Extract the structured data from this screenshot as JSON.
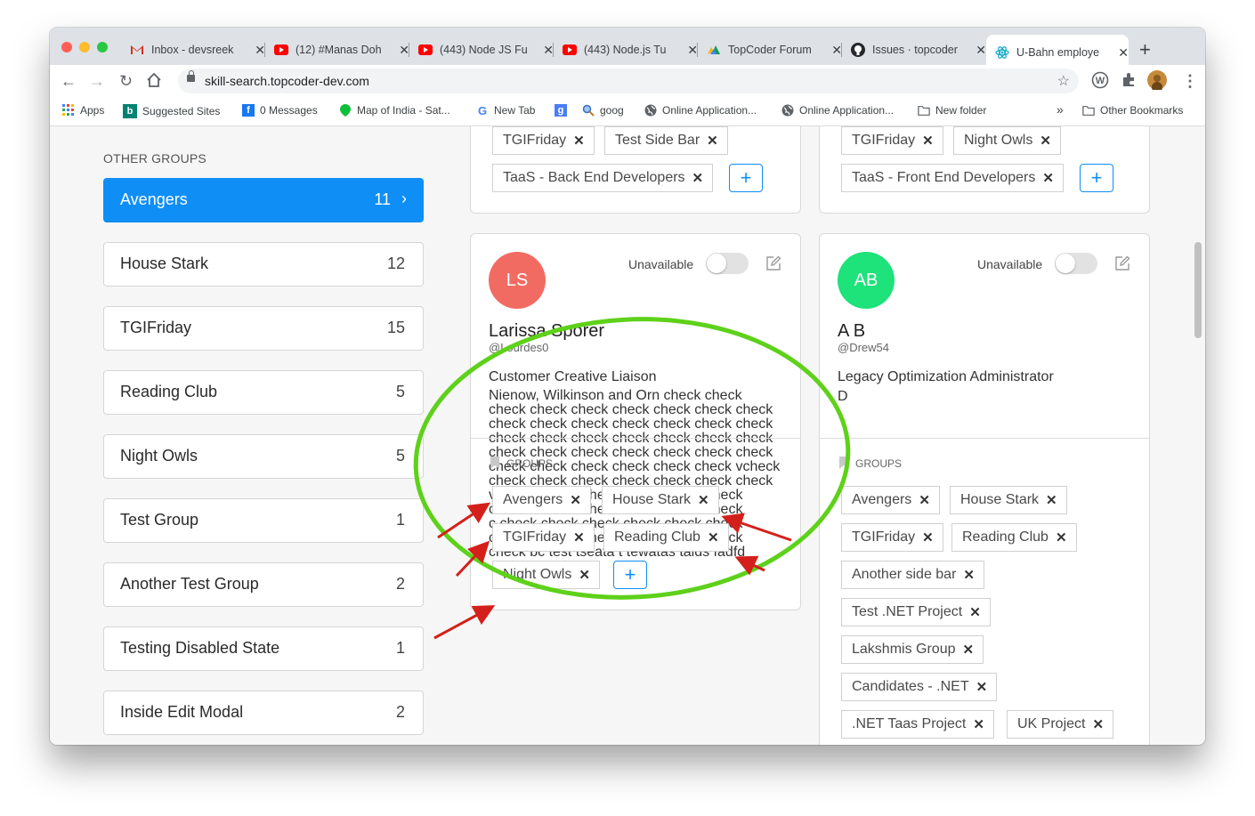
{
  "browser": {
    "tabs": [
      {
        "title": "Inbox - devsreek",
        "icon": "gmail-icon"
      },
      {
        "title": "(12) #Manas Doh",
        "icon": "youtube-icon"
      },
      {
        "title": "(443) Node JS Fu",
        "icon": "youtube-icon"
      },
      {
        "title": "(443) Node.js Tu",
        "icon": "youtube-icon"
      },
      {
        "title": "TopCoder Forum",
        "icon": "topcoder-icon"
      },
      {
        "title": "Issues · topcoder",
        "icon": "github-icon"
      },
      {
        "title": "U-Bahn employe",
        "icon": "react-icon"
      }
    ],
    "url": "skill-search.topcoder-dev.com",
    "bookmarks": [
      "Apps",
      "Suggested Sites",
      "0 Messages",
      "Map of India - Sat...",
      "New Tab",
      "goog",
      "Online Application...",
      "Online Application...",
      "New folder"
    ],
    "other_bookmarks": "Other Bookmarks",
    "overflow": "»"
  },
  "sidebar": {
    "section_label": "OTHER GROUPS",
    "groups": [
      {
        "name": "Avengers",
        "count": "11",
        "active": true
      },
      {
        "name": "House Stark",
        "count": "12"
      },
      {
        "name": "TGIFriday",
        "count": "15"
      },
      {
        "name": "Reading Club",
        "count": "5"
      },
      {
        "name": "Night Owls",
        "count": "5"
      },
      {
        "name": "Test Group",
        "count": "1"
      },
      {
        "name": "Another Test Group",
        "count": "2"
      },
      {
        "name": "Testing Disabled State",
        "count": "1"
      },
      {
        "name": "Inside Edit Modal",
        "count": "2"
      }
    ]
  },
  "top_cards": [
    {
      "chips": [
        "TGIFriday",
        "Test Side Bar",
        "TaaS - Back End Developers"
      ]
    },
    {
      "chips": [
        "TGIFriday",
        "Night Owls",
        "TaaS - Front End Developers"
      ]
    }
  ],
  "cards": [
    {
      "initials": "LS",
      "avatar_color": "#f26b63",
      "availability": "Unavailable",
      "name": "Larissa Sporer",
      "handle": "@Lourdes0",
      "title": "Customer Creative Liaison",
      "description_lines": [
        "Nienow, Wilkinson and Orn check check",
        "check check check check check check check",
        "check check check check check check check",
        "check check check check check check check",
        "check check check check check check check",
        "check check check check check check vcheck",
        "check check check check check check check",
        "v check check check check check check",
        "c check check check check check check",
        "c check check check check check check",
        "c check check check check check check",
        "check bc test tseata t tewatas taids fadfd"
      ],
      "groups_label": "GROUPS",
      "groups": [
        "Avengers",
        "House Stark",
        "TGIFriday",
        "Reading Club",
        "Night Owls"
      ]
    },
    {
      "initials": "AB",
      "avatar_color": "#1ee27a",
      "availability": "Unavailable",
      "name": "A B",
      "handle": "@Drew54",
      "title": "Legacy Optimization Administrator",
      "description": "D",
      "groups_label": "GROUPS",
      "groups": [
        "Avengers",
        "House Stark",
        "TGIFriday",
        "Reading Club",
        "Another side bar",
        "Test .NET Project",
        "Lakshmis Group",
        "Candidates - .NET",
        ".NET Taas Project",
        "UK Project"
      ]
    }
  ],
  "add_label": "+",
  "close_glyph": "✕",
  "annotation_colors": {
    "ellipse": "#5ed11a",
    "arrows": "#d4201a"
  }
}
